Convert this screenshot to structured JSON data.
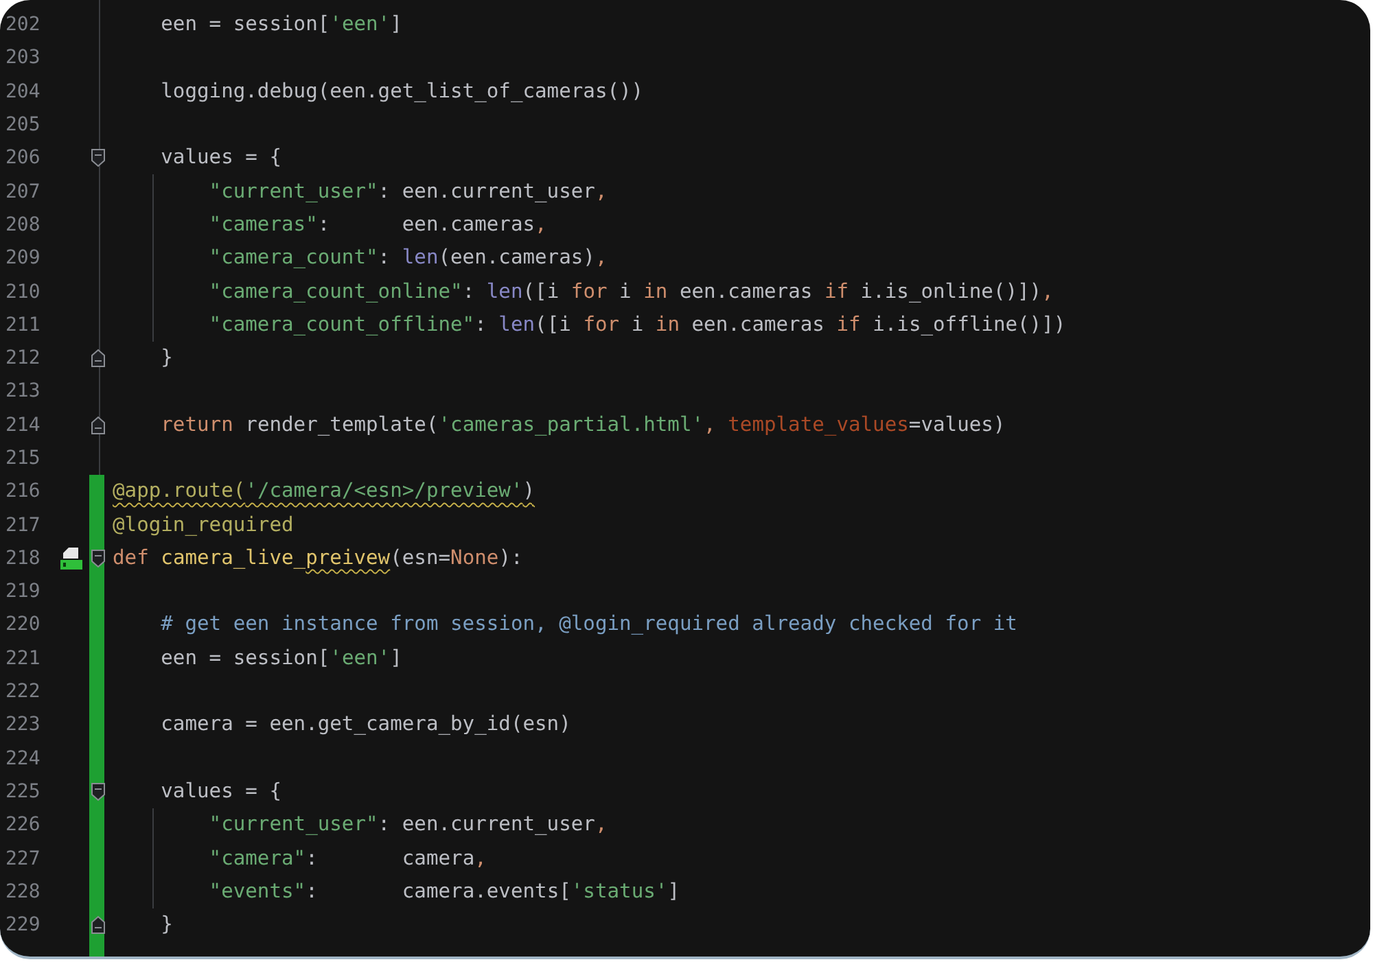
{
  "editor": {
    "lines": [
      {
        "number": "202",
        "changed": false,
        "fold_start": false,
        "fold_end": false,
        "bookmark": false,
        "tokens": [
          {
            "text": "    een = session[",
            "kind": "plain"
          },
          {
            "text": "'een'",
            "kind": "string"
          },
          {
            "text": "]",
            "kind": "plain"
          }
        ]
      },
      {
        "number": "203",
        "changed": false,
        "fold_start": false,
        "fold_end": false,
        "bookmark": false
      },
      {
        "number": "204",
        "changed": false,
        "fold_start": false,
        "fold_end": false,
        "bookmark": false,
        "tokens": [
          {
            "text": "    logging.debug(een.get_list_of_cameras())",
            "kind": "plain"
          }
        ]
      },
      {
        "number": "205",
        "changed": false,
        "fold_start": false,
        "fold_end": false,
        "bookmark": false
      },
      {
        "number": "206",
        "changed": false,
        "fold_start": true,
        "fold_end": false,
        "bookmark": false,
        "tokens": [
          {
            "text": "    values = {",
            "kind": "plain"
          }
        ]
      },
      {
        "number": "207",
        "changed": false,
        "fold_start": false,
        "fold_end": false,
        "bookmark": false,
        "tokens": [
          {
            "text": "        \"current_user\"",
            "kind": "string"
          },
          {
            "text": ": een.current_user",
            "kind": "plain"
          },
          {
            "text": ",",
            "kind": "keyword"
          }
        ]
      },
      {
        "number": "208",
        "changed": false,
        "fold_start": false,
        "fold_end": false,
        "bookmark": false,
        "tokens": [
          {
            "text": "        \"cameras\"",
            "kind": "string"
          },
          {
            "text": ":      een.cameras",
            "kind": "plain"
          },
          {
            "text": ",",
            "kind": "keyword"
          }
        ]
      },
      {
        "number": "209",
        "changed": false,
        "fold_start": false,
        "fold_end": false,
        "bookmark": false,
        "tokens": [
          {
            "text": "        \"camera_count\"",
            "kind": "string"
          },
          {
            "text": ": ",
            "kind": "plain"
          },
          {
            "text": "len",
            "kind": "builtin"
          },
          {
            "text": "(een.cameras)",
            "kind": "plain"
          },
          {
            "text": ",",
            "kind": "keyword"
          }
        ]
      },
      {
        "number": "210",
        "changed": false,
        "fold_start": false,
        "fold_end": false,
        "bookmark": false,
        "tokens": [
          {
            "text": "        \"camera_count_online\"",
            "kind": "string"
          },
          {
            "text": ": ",
            "kind": "plain"
          },
          {
            "text": "len",
            "kind": "builtin"
          },
          {
            "text": "([i ",
            "kind": "plain"
          },
          {
            "text": "for",
            "kind": "keyword"
          },
          {
            "text": " i ",
            "kind": "plain"
          },
          {
            "text": "in",
            "kind": "keyword"
          },
          {
            "text": " een.cameras ",
            "kind": "plain"
          },
          {
            "text": "if",
            "kind": "keyword"
          },
          {
            "text": " i.is_online()])",
            "kind": "plain"
          },
          {
            "text": ",",
            "kind": "keyword"
          }
        ]
      },
      {
        "number": "211",
        "changed": false,
        "fold_start": false,
        "fold_end": false,
        "bookmark": false,
        "tokens": [
          {
            "text": "        \"camera_count_offline\"",
            "kind": "string"
          },
          {
            "text": ": ",
            "kind": "plain"
          },
          {
            "text": "len",
            "kind": "builtin"
          },
          {
            "text": "([i ",
            "kind": "plain"
          },
          {
            "text": "for",
            "kind": "keyword"
          },
          {
            "text": " i ",
            "kind": "plain"
          },
          {
            "text": "in",
            "kind": "keyword"
          },
          {
            "text": " een.cameras ",
            "kind": "plain"
          },
          {
            "text": "if",
            "kind": "keyword"
          },
          {
            "text": " i.is_offline()])",
            "kind": "plain"
          }
        ]
      },
      {
        "number": "212",
        "changed": false,
        "fold_start": false,
        "fold_end": true,
        "bookmark": false,
        "tokens": [
          {
            "text": "    }",
            "kind": "plain"
          }
        ]
      },
      {
        "number": "213",
        "changed": false,
        "fold_start": false,
        "fold_end": false,
        "bookmark": false
      },
      {
        "number": "214",
        "changed": false,
        "fold_start": false,
        "fold_end": true,
        "bookmark": false,
        "tokens": [
          {
            "text": "    return",
            "kind": "keyword"
          },
          {
            "text": " render_template(",
            "kind": "plain"
          },
          {
            "text": "'cameras_partial.html'",
            "kind": "string"
          },
          {
            "text": ", ",
            "kind": "keyword"
          },
          {
            "text": "template_values",
            "kind": "kwarg"
          },
          {
            "text": "=values)",
            "kind": "plain"
          }
        ]
      },
      {
        "number": "215",
        "changed": false,
        "fold_start": false,
        "fold_end": false,
        "bookmark": false
      },
      {
        "number": "216",
        "changed": true,
        "fold_start": false,
        "fold_end": false,
        "bookmark": false,
        "tokens": [
          {
            "text": "@app.route(",
            "kind": "decorator",
            "squiggle": true
          },
          {
            "text": "'/camera/<esn>/preview'",
            "kind": "string",
            "squiggle": true
          },
          {
            "text": ")",
            "kind": "plain",
            "squiggle": true
          }
        ]
      },
      {
        "number": "217",
        "changed": true,
        "fold_start": false,
        "fold_end": false,
        "bookmark": false,
        "tokens": [
          {
            "text": "@login_required",
            "kind": "decorator",
            "squiggle": false
          }
        ]
      },
      {
        "number": "218",
        "changed": true,
        "fold_start": true,
        "fold_end": false,
        "bookmark": true,
        "tokens": [
          {
            "text": "def ",
            "kind": "keyword"
          },
          {
            "text": "camera_live_",
            "kind": "funcname",
            "squiggle": false
          },
          {
            "text": "preivew",
            "kind": "funcname",
            "squiggle": true
          },
          {
            "text": "(esn=",
            "kind": "plain"
          },
          {
            "text": "None",
            "kind": "keyword"
          },
          {
            "text": "):",
            "kind": "plain"
          }
        ]
      },
      {
        "number": "219",
        "changed": true,
        "fold_start": false,
        "fold_end": false,
        "bookmark": false
      },
      {
        "number": "220",
        "changed": true,
        "fold_start": false,
        "fold_end": false,
        "bookmark": false,
        "tokens": [
          {
            "text": "    # get een instance from session, @login_required already checked for it",
            "kind": "comment"
          }
        ]
      },
      {
        "number": "221",
        "changed": true,
        "fold_start": false,
        "fold_end": false,
        "bookmark": false,
        "tokens": [
          {
            "text": "    een = session[",
            "kind": "plain"
          },
          {
            "text": "'een'",
            "kind": "string"
          },
          {
            "text": "]",
            "kind": "plain"
          }
        ]
      },
      {
        "number": "222",
        "changed": true,
        "fold_start": false,
        "fold_end": false,
        "bookmark": false
      },
      {
        "number": "223",
        "changed": true,
        "fold_start": false,
        "fold_end": false,
        "bookmark": false,
        "tokens": [
          {
            "text": "    camera = een.get_camera_by_id(esn)",
            "kind": "plain"
          }
        ]
      },
      {
        "number": "224",
        "changed": true,
        "fold_start": false,
        "fold_end": false,
        "bookmark": false
      },
      {
        "number": "225",
        "changed": true,
        "fold_start": true,
        "fold_end": false,
        "bookmark": false,
        "tokens": [
          {
            "text": "    values = {",
            "kind": "plain"
          }
        ]
      },
      {
        "number": "226",
        "changed": true,
        "fold_start": false,
        "fold_end": false,
        "bookmark": false,
        "tokens": [
          {
            "text": "        \"current_user\"",
            "kind": "string"
          },
          {
            "text": ": een.current_user",
            "kind": "plain"
          },
          {
            "text": ",",
            "kind": "keyword"
          }
        ]
      },
      {
        "number": "227",
        "changed": true,
        "fold_start": false,
        "fold_end": false,
        "bookmark": false,
        "tokens": [
          {
            "text": "        \"camera\"",
            "kind": "string"
          },
          {
            "text": ":       camera",
            "kind": "plain"
          },
          {
            "text": ",",
            "kind": "keyword"
          }
        ]
      },
      {
        "number": "228",
        "changed": true,
        "fold_start": false,
        "fold_end": false,
        "bookmark": false,
        "tokens": [
          {
            "text": "        \"events\"",
            "kind": "string"
          },
          {
            "text": ":       camera.events[",
            "kind": "plain"
          },
          {
            "text": "'status'",
            "kind": "string"
          },
          {
            "text": "]",
            "kind": "plain"
          }
        ]
      },
      {
        "number": "229",
        "changed": true,
        "fold_start": false,
        "fold_end": true,
        "bookmark": false,
        "tokens": [
          {
            "text": "    }",
            "kind": "plain"
          }
        ]
      }
    ]
  }
}
